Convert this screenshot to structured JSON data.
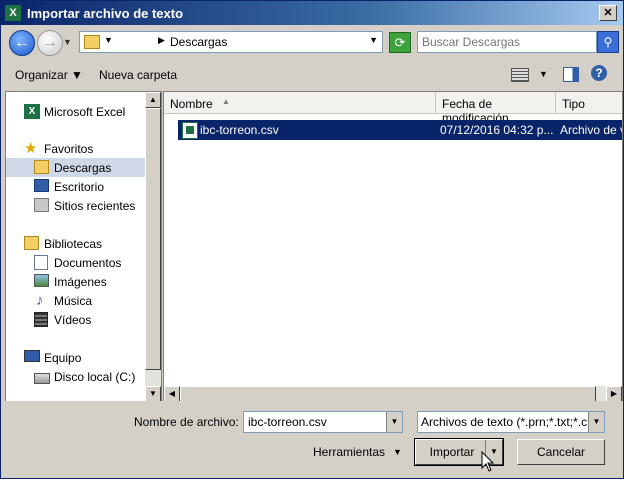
{
  "window": {
    "title": "Importar archivo de texto"
  },
  "address": {
    "location": "Descargas",
    "search_placeholder": "Buscar Descargas"
  },
  "toolbar": {
    "organize": "Organizar",
    "new_folder": "Nueva carpeta"
  },
  "sidebar": {
    "app": "Microsoft Excel",
    "favorites": "Favoritos",
    "downloads": "Descargas",
    "desktop": "Escritorio",
    "recent": "Sitios recientes",
    "libraries": "Bibliotecas",
    "documents": "Documentos",
    "images": "Imágenes",
    "music": "Música",
    "videos": "Vídeos",
    "computer": "Equipo",
    "local_disk": "Disco local (C:)"
  },
  "columns": {
    "name": "Nombre",
    "modified": "Fecha de modificación",
    "type": "Tipo"
  },
  "files": [
    {
      "name": "ibc-torreon.csv",
      "modified": "07/12/2016 04:32 p...",
      "type": "Archivo de v"
    }
  ],
  "footer": {
    "filename_label": "Nombre de archivo:",
    "filename_value": "ibc-torreon.csv",
    "filetype": "Archivos de texto (*.prn;*.txt;*.c",
    "tools": "Herramientas",
    "import": "Importar",
    "cancel": "Cancelar"
  },
  "colors": {
    "title_bar": "#0a246a",
    "selection": "#0a246a",
    "excel_green": "#1e7145"
  }
}
